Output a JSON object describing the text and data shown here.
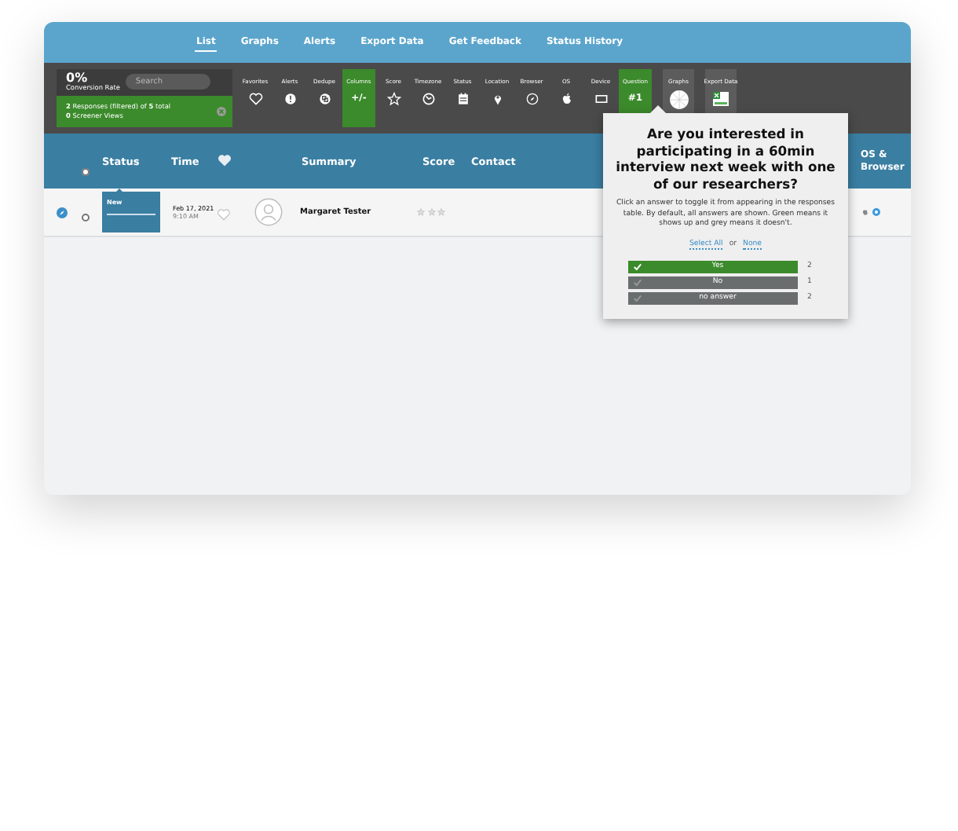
{
  "nav": [
    {
      "label": "List",
      "selected": true
    },
    {
      "label": "Graphs",
      "selected": false
    },
    {
      "label": "Alerts",
      "selected": false
    },
    {
      "label": "Export Data",
      "selected": false
    },
    {
      "label": "Get Feedback",
      "selected": false
    },
    {
      "label": "Status History",
      "selected": false
    }
  ],
  "summary_panel": {
    "rate": "0%",
    "rate_label": "Conversion Rate",
    "search": {
      "placeholder": "Search"
    },
    "filter_line_1": "**2** Responses (filtered) of **5** total",
    "filter_line_2": "**0** Screener Views"
  },
  "tools": [
    {
      "label": "Favorites",
      "selected": false
    },
    {
      "label": "Alerts",
      "selected": false
    },
    {
      "label": "Dedupe",
      "selected": false
    },
    {
      "label": "Columns",
      "symbol": "+/-",
      "selected": true
    },
    {
      "label": "Score",
      "selected": false
    },
    {
      "label": "Timezone",
      "selected": false
    },
    {
      "label": "Status",
      "selected": false
    },
    {
      "label": "Location",
      "selected": false
    },
    {
      "label": "Browser",
      "selected": false
    },
    {
      "label": "OS",
      "selected": false
    },
    {
      "label": "Device",
      "selected": false
    },
    {
      "label": "Question",
      "symbol": "#1",
      "selected": true
    }
  ],
  "tiles": [
    {
      "label": "Graphs"
    },
    {
      "label": "Export Data"
    }
  ],
  "table": {
    "all_checked": false,
    "columns": [
      "Status",
      "Time",
      "Summary",
      "Score",
      "Contact",
      "OS & Browser"
    ],
    "rows": [
      {
        "checked": false,
        "status": "New",
        "date": "Feb 17, 2021",
        "time": "9:10 AM",
        "favorite": false,
        "name": "Margaret Tester",
        "stars": 0
      }
    ]
  },
  "popup": {
    "title": "Are you interested in participating in a 60min interview next week with one of our researchers?",
    "description": "Click an answer to toggle it from appearing in the responses table. By default, all answers are shown. Green means it shows up and grey means it doesn't.",
    "select_all": "Select All",
    "or": "or",
    "none": "None",
    "answers": [
      {
        "label": "Yes",
        "count": "2",
        "selected": true
      },
      {
        "label": "No",
        "count": "1",
        "selected": false
      },
      {
        "label": "no answer",
        "count": "2",
        "selected": false
      }
    ]
  }
}
